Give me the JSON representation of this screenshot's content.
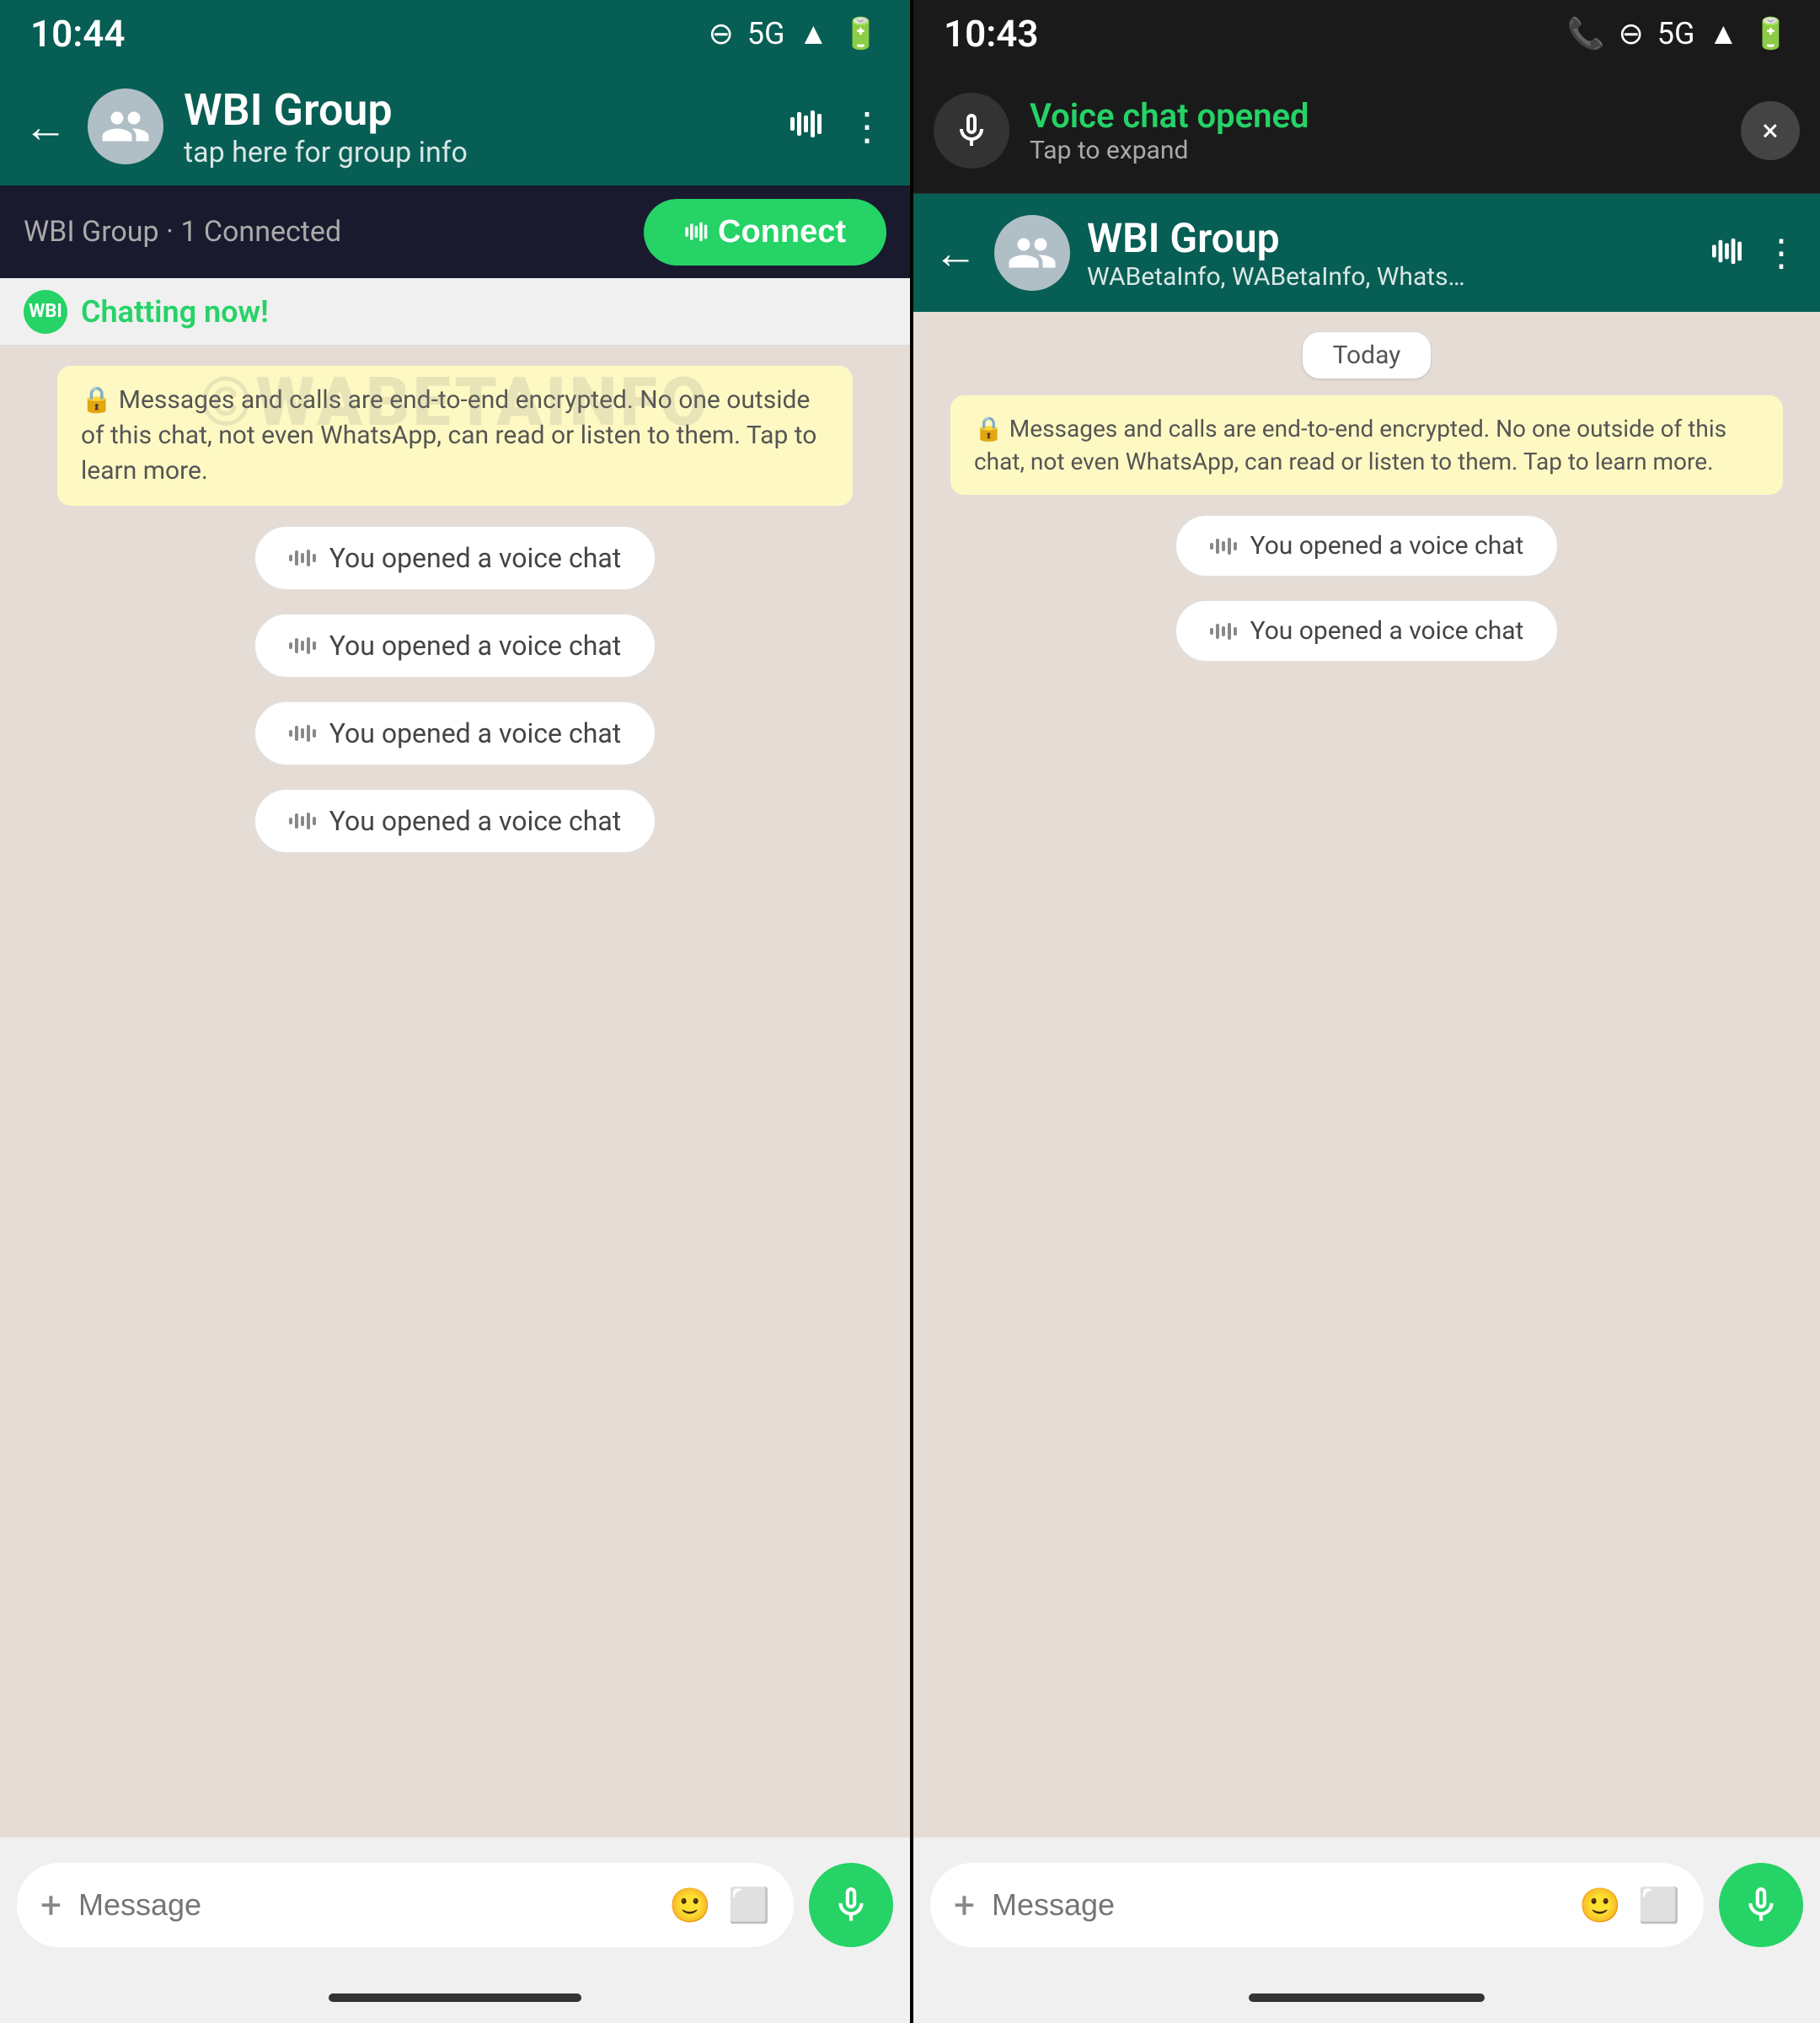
{
  "left": {
    "status_bar": {
      "time": "10:44",
      "signal": "5G",
      "icons": "🔇 5G▲ 🔋"
    },
    "header": {
      "back_label": "←",
      "group_name": "WBI Group",
      "group_sub": "tap here for group info",
      "wave_icon": "audio-wave",
      "menu_icon": "more-options"
    },
    "voice_banner": {
      "connected_text": "WBI Group · 1 Connected",
      "connect_label": "Connect"
    },
    "chatting_bar": {
      "badge_text": "WBI",
      "chatting_label": "Chatting now!"
    },
    "encryption_notice": "🔒 Messages and calls are end-to-end encrypted. No one outside of this chat, not even WhatsApp, can read or listen to them. Tap to learn more.",
    "voice_messages": [
      "You opened a voice chat",
      "You opened a voice chat",
      "You opened a voice chat",
      "You opened a voice chat"
    ],
    "input": {
      "placeholder": "Message",
      "plus_icon": "+",
      "emoji_icon": "😊",
      "camera_icon": "📷"
    }
  },
  "right": {
    "status_bar": {
      "time": "10:43",
      "icons": "📞 🔇 5G▲ 🔋"
    },
    "voice_notif": {
      "title": "Voice chat opened",
      "subtitle": "Tap to expand",
      "close_icon": "×"
    },
    "header": {
      "back_label": "←",
      "group_name": "WBI Group",
      "group_sub": "WABetaInfo, WABetaInfo, Whats…",
      "wave_icon": "audio-wave",
      "menu_icon": "more-options"
    },
    "watermark": "©WABETAINFO",
    "today_label": "Today",
    "encryption_notice": "🔒 Messages and calls are end-to-end encrypted. No one outside of this chat, not even WhatsApp, can read or listen to them. Tap to learn more.",
    "voice_messages": [
      "You opened a voice chat",
      "You opened a voice chat"
    ],
    "input": {
      "placeholder": "Message",
      "plus_icon": "+",
      "emoji_icon": "😊",
      "camera_icon": "📷"
    }
  }
}
